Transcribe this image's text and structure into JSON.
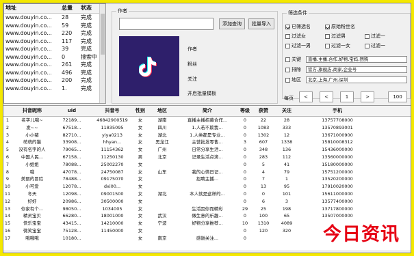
{
  "url_list": {
    "headers": [
      "地址",
      "总量",
      "状态"
    ],
    "rows": [
      [
        "www.douyin.co...",
        "28",
        "完成"
      ],
      [
        "www.douyin.co...",
        "59",
        "完成"
      ],
      [
        "www.douyin.co...",
        "220",
        "完成"
      ],
      [
        "www.douyin.co...",
        "117",
        "完成"
      ],
      [
        "www.douyin.co...",
        "39",
        "完成"
      ],
      [
        "www.douyin.co...",
        "0",
        "搜索中"
      ],
      [
        "www.douyin.co...",
        "261",
        "完成"
      ],
      [
        "www.douyin.co...",
        "496",
        "完成"
      ],
      [
        "www.douyin.co...",
        "200",
        "完成"
      ],
      [
        "www.douyin.co...",
        "1.",
        "完成"
      ]
    ]
  },
  "author": {
    "group_title": "作者",
    "input_value": "",
    "query_button": "添加查询",
    "import_button": "批量导入",
    "fields": [
      "作者",
      "粉丝",
      "关注",
      "开启批量模板"
    ]
  },
  "filter": {
    "group_title": "筛选条件",
    "checkboxes": [
      {
        "label": "已筛选名",
        "checked": true
      },
      {
        "label": "原始粉丝名",
        "checked": true
      },
      {
        "label": "过滤女",
        "checked": false
      },
      {
        "label": "过滤男",
        "checked": false
      },
      {
        "label": "过滤一",
        "checked": false
      },
      {
        "label": "过滤一男",
        "checked": false
      },
      {
        "label": "过滤一女",
        "checked": false
      },
      {
        "label": "过滤一",
        "checked": false
      }
    ],
    "keyword_label": "关键",
    "keyword_value": "直播,主播,合作,好物,宝妈,团购",
    "exclude_label": "排除",
    "exclude_value": "官方,旗舰店,商家,企业号",
    "region_label": "地区",
    "region_value": "北京,上海,广州,深圳",
    "pager_label": "每页",
    "pager_prev": "<",
    "pager_page": "1",
    "pager_next": ">",
    "page_size": "100"
  },
  "table": {
    "headers": [
      "",
      "抖音昵称",
      "uid",
      "抖音号",
      "性别",
      "地区",
      "简介",
      "等级",
      "获赞",
      "关注",
      "手机"
    ],
    "rows": [
      [
        "1",
        "名字儿哦~",
        "72189...",
        "46842900519",
        "女",
        "湖南",
        "直播主播招募合作...",
        "0",
        "22",
        "28",
        "13757708000"
      ],
      [
        "2",
        "发~~",
        "67518...",
        "11835095",
        "女",
        "四川",
        "1.人若不欺我...",
        "0",
        "1083",
        "333",
        "13570893001"
      ],
      [
        "3",
        "小小猪",
        "82710...",
        "yiya0213",
        "女",
        "湖北",
        "1.人类都是专业...",
        "0",
        "1302",
        "12",
        "13671000900"
      ],
      [
        "4",
        "萌萌的猫",
        "33908...",
        "hhyan...",
        "女",
        "黑龙江",
        "主营批发零售...",
        "3",
        "607",
        "1338",
        "15810008312"
      ],
      [
        "5",
        "没有名字的人",
        "79065...",
        "11154362",
        "女",
        "广州",
        "日常分享生活...",
        "0",
        "348",
        "136",
        "15436000000"
      ],
      [
        "6",
        "中国人民...",
        "67158...",
        "11250130",
        "男",
        "北京",
        "记录生活点滴...",
        "0",
        "283",
        "112",
        "13560000000"
      ],
      [
        "7",
        "小姐姐",
        "78088...",
        "25002270",
        "女",
        "",
        "",
        "0",
        "5",
        "41",
        "15180000000"
      ],
      [
        "8",
        "哦",
        "47078...",
        "24750087",
        "女",
        "山东",
        "我的心情日记...",
        "0",
        "4",
        "79",
        "15751200000"
      ],
      [
        "9",
        "美丽的冒险",
        "78488...",
        "09175070",
        "女",
        "",
        "招聘主播...",
        "0",
        "7",
        "1",
        "13520200000"
      ],
      [
        "10",
        "小可爱",
        "12078...",
        "dxi00...",
        "女",
        "",
        "",
        "0",
        "13",
        "95",
        "17910020000"
      ],
      [
        "11",
        "冬天",
        "12098...",
        "09001500",
        "女",
        "湖北",
        "本人就是这样的...",
        "0",
        "0",
        "101",
        "15611000000"
      ],
      [
        "12",
        "好好",
        "20986...",
        "30500000",
        "女",
        "",
        "",
        "0",
        "6",
        "3",
        "13577400000"
      ],
      [
        "13",
        "你家有个...",
        "98050...",
        "1034005",
        "女",
        "",
        "生活因你而精彩",
        "29",
        "25",
        "198",
        "13717800000"
      ],
      [
        "14",
        "精灵宝贝",
        "66280...",
        "18001000",
        "女",
        "武汉",
        "做生意的乐趣...",
        "0",
        "100",
        "65",
        "13507000000"
      ],
      [
        "15",
        "快乐宝宝",
        "43415...",
        "14210000",
        "女",
        "宁波",
        "好物分享推荐...",
        "10",
        "1310",
        "4089",
        "18580000000"
      ],
      [
        "16",
        "微笑宝宝",
        "75128...",
        "11450000",
        "女",
        "",
        "",
        "0",
        "120",
        "320",
        "13000000000"
      ],
      [
        "17",
        "哦哦哦",
        "10180...",
        "",
        "女",
        "南京",
        "感谢关注...",
        "0",
        "",
        "",
        ""
      ]
    ]
  },
  "watermark": "今日资讯"
}
